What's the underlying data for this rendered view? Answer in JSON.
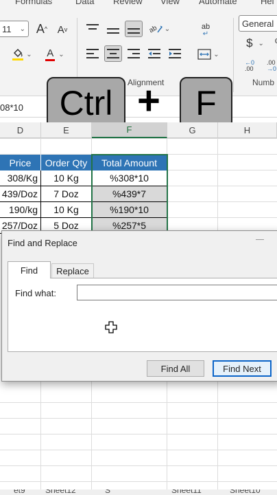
{
  "ribbon": {
    "menu_tabs": [
      "Formulas",
      "Data",
      "Review",
      "View",
      "Automate",
      "Hel"
    ],
    "font_size_value": "11",
    "grow_font_glyph": "A",
    "shrink_font_glyph": "A",
    "font_color_glyph": "A",
    "wrap_glyph": "ab",
    "number_format_value": "General",
    "currency_glyph": "$",
    "percent_glyph": "%",
    "inc_decimal_glyph": ".00",
    "dec_decimal_glyph": ".00",
    "alignment_group_label": "Alignment",
    "number_group_label": "Numb"
  },
  "overlay": {
    "key1": "Ctrl",
    "plus": "+",
    "key2": "F"
  },
  "formula_bar": {
    "text": "08*10"
  },
  "grid": {
    "columns": [
      "D",
      "E",
      "F",
      "G",
      "H"
    ],
    "selected_column": "F",
    "headers": [
      "Price",
      "Order Qty",
      "Total Amount"
    ],
    "rows": [
      [
        "308/Kg",
        "10 Kg",
        "%308*10"
      ],
      [
        "439/Doz",
        "7 Doz",
        "%439*7"
      ],
      [
        "190/kg",
        "10 Kg",
        "%190*10"
      ],
      [
        "257/Doz",
        "5 Doz",
        "%257*5"
      ]
    ]
  },
  "dialog": {
    "title": "Find and Replace",
    "tabs": [
      "Find",
      "Replace"
    ],
    "find_label": "Find what:",
    "find_value": "",
    "buttons": {
      "find_all": "Find All",
      "find_next": "Find Next"
    }
  },
  "sheet_tabs": [
    "et9",
    "Sheet12",
    "S",
    "Sheet11",
    "Sheet10"
  ],
  "colors": {
    "header_blue": "#2e74b5",
    "excel_green": "#217346",
    "focus_blue": "#0a64c8"
  }
}
